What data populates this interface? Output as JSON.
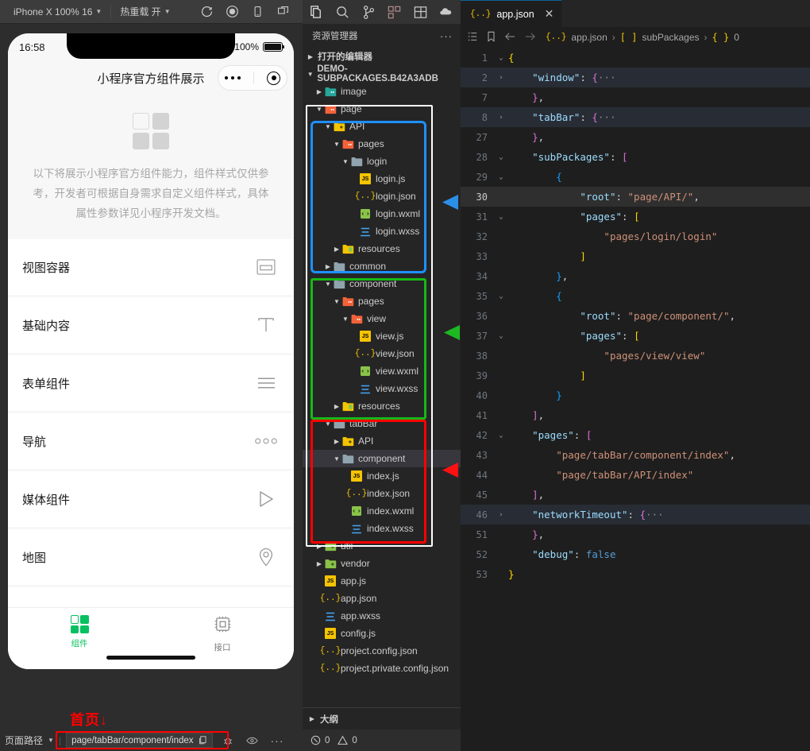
{
  "simulator": {
    "toolbar": {
      "device": "iPhone X 100% 16",
      "hotreload": "热重载 开",
      "icons": [
        "refresh-icon",
        "record-icon",
        "phone-icon",
        "windows-icon"
      ]
    },
    "phone": {
      "status_time": "16:58",
      "battery_percent": "100%",
      "nav_title": "小程序官方组件展示",
      "intro_text": "以下将展示小程序官方组件能力，组件样式仅供参考，开发者可根据自身需求自定义组件样式，具体属性参数详见小程序开发文档。",
      "cards": [
        {
          "label": "视图容器",
          "icon": "view-container-icon"
        },
        {
          "label": "基础内容",
          "icon": "text-format-icon"
        },
        {
          "label": "表单组件",
          "icon": "list-lines-icon"
        },
        {
          "label": "导航",
          "icon": "three-circles-icon"
        },
        {
          "label": "媒体组件",
          "icon": "play-triangle-icon"
        },
        {
          "label": "地图",
          "icon": "map-pin-icon"
        }
      ],
      "tabs": [
        {
          "label": "组件",
          "icon": "grid-icon",
          "active": true
        },
        {
          "label": "接口",
          "icon": "chip-icon",
          "active": false
        }
      ]
    },
    "annotation_home": "首页↓",
    "statusbar": {
      "label": "页面路径",
      "path_value": "page/tabBar/component/index",
      "icons": [
        "copy-icon",
        "debug-icon",
        "eye-icon",
        "more-icon"
      ]
    }
  },
  "explorer": {
    "activity_icons": [
      "files-icon",
      "search-icon",
      "source-control-icon",
      "extensions-icon",
      "layout-icon",
      "cloud-icon"
    ],
    "title": "资源管理器",
    "more": "···",
    "open_editors": "打开的编辑器",
    "project": "DEMO-SUBPACKAGES.B42A3ADB",
    "tree": [
      {
        "label": "image",
        "depth": 1,
        "kind": "folder-img",
        "expanded": false,
        "selected": false
      },
      {
        "label": "page",
        "depth": 1,
        "kind": "folder-page",
        "expanded": true,
        "selected": false
      },
      {
        "label": "API",
        "depth": 2,
        "kind": "folder-api",
        "expanded": true,
        "selected": false
      },
      {
        "label": "pages",
        "depth": 3,
        "kind": "folder-page",
        "expanded": true,
        "selected": false
      },
      {
        "label": "login",
        "depth": 4,
        "kind": "folder",
        "expanded": true,
        "selected": false
      },
      {
        "label": "login.js",
        "depth": 5,
        "kind": "js",
        "selected": false
      },
      {
        "label": "login.json",
        "depth": 5,
        "kind": "json",
        "selected": false
      },
      {
        "label": "login.wxml",
        "depth": 5,
        "kind": "wxml",
        "selected": false
      },
      {
        "label": "login.wxss",
        "depth": 5,
        "kind": "wxss",
        "selected": false
      },
      {
        "label": "resources",
        "depth": 3,
        "kind": "folder-res",
        "expanded": false,
        "selected": false
      },
      {
        "label": "common",
        "depth": 2,
        "kind": "folder-gray",
        "expanded": false,
        "selected": false
      },
      {
        "label": "component",
        "depth": 2,
        "kind": "folder",
        "expanded": true,
        "selected": false
      },
      {
        "label": "pages",
        "depth": 3,
        "kind": "folder-page",
        "expanded": true,
        "selected": false
      },
      {
        "label": "view",
        "depth": 4,
        "kind": "folder-page",
        "expanded": true,
        "selected": false
      },
      {
        "label": "view.js",
        "depth": 5,
        "kind": "js",
        "selected": false
      },
      {
        "label": "view.json",
        "depth": 5,
        "kind": "json",
        "selected": false
      },
      {
        "label": "view.wxml",
        "depth": 5,
        "kind": "wxml",
        "selected": false
      },
      {
        "label": "view.wxss",
        "depth": 5,
        "kind": "wxss",
        "selected": false
      },
      {
        "label": "resources",
        "depth": 3,
        "kind": "folder-res",
        "expanded": false,
        "selected": false
      },
      {
        "label": "tabBar",
        "depth": 2,
        "kind": "folder",
        "expanded": true,
        "selected": false
      },
      {
        "label": "API",
        "depth": 3,
        "kind": "folder-api",
        "expanded": false,
        "selected": false
      },
      {
        "label": "component",
        "depth": 3,
        "kind": "folder",
        "expanded": true,
        "selected": true
      },
      {
        "label": "index.js",
        "depth": 4,
        "kind": "js",
        "selected": false
      },
      {
        "label": "index.json",
        "depth": 4,
        "kind": "json",
        "selected": false
      },
      {
        "label": "index.wxml",
        "depth": 4,
        "kind": "wxml",
        "selected": false
      },
      {
        "label": "index.wxss",
        "depth": 4,
        "kind": "wxss",
        "selected": false
      },
      {
        "label": "util",
        "depth": 1,
        "kind": "folder-util",
        "expanded": false,
        "selected": false
      },
      {
        "label": "vendor",
        "depth": 1,
        "kind": "folder-util",
        "expanded": false,
        "selected": false
      },
      {
        "label": "app.js",
        "depth": 1,
        "kind": "js",
        "selected": false
      },
      {
        "label": "app.json",
        "depth": 1,
        "kind": "json",
        "selected": false
      },
      {
        "label": "app.wxss",
        "depth": 1,
        "kind": "wxss",
        "selected": false
      },
      {
        "label": "config.js",
        "depth": 1,
        "kind": "js",
        "selected": false
      },
      {
        "label": "project.config.json",
        "depth": 1,
        "kind": "json",
        "selected": false
      },
      {
        "label": "project.private.config.json",
        "depth": 1,
        "kind": "json",
        "selected": false
      }
    ],
    "outline": "大纲",
    "status": {
      "errors": "0",
      "warnings": "0"
    }
  },
  "editor": {
    "tab": {
      "label": "app.json",
      "close": "✕"
    },
    "breadcrumb": {
      "file": "app.json",
      "sep1": "›",
      "array": "subPackages",
      "sep2": "›",
      "index": "0"
    },
    "lines": [
      {
        "num": "1",
        "fold": "v",
        "indent": 0,
        "parts": [
          {
            "t": "{",
            "c": "br1"
          }
        ]
      },
      {
        "num": "2",
        "fold": ">",
        "indent": 1,
        "hl": true,
        "parts": [
          {
            "t": "\"window\"",
            "c": "k"
          },
          {
            "t": ": ",
            "c": "p"
          },
          {
            "t": "{",
            "c": "br2"
          },
          {
            "t": "···",
            "c": "ell"
          }
        ]
      },
      {
        "num": "7",
        "fold": "",
        "indent": 1,
        "parts": [
          {
            "t": "}",
            "c": "br2"
          },
          {
            "t": ",",
            "c": "p"
          }
        ]
      },
      {
        "num": "8",
        "fold": ">",
        "indent": 1,
        "hl": true,
        "parts": [
          {
            "t": "\"tabBar\"",
            "c": "k"
          },
          {
            "t": ": ",
            "c": "p"
          },
          {
            "t": "{",
            "c": "br2"
          },
          {
            "t": "···",
            "c": "ell"
          }
        ]
      },
      {
        "num": "27",
        "fold": "",
        "indent": 1,
        "parts": [
          {
            "t": "}",
            "c": "br2"
          },
          {
            "t": ",",
            "c": "p"
          }
        ]
      },
      {
        "num": "28",
        "fold": "v",
        "indent": 1,
        "parts": [
          {
            "t": "\"subPackages\"",
            "c": "k"
          },
          {
            "t": ": ",
            "c": "p"
          },
          {
            "t": "[",
            "c": "br2"
          }
        ]
      },
      {
        "num": "29",
        "fold": "v",
        "indent": 2,
        "parts": [
          {
            "t": "{",
            "c": "br3"
          }
        ]
      },
      {
        "num": "30",
        "fold": "",
        "indent": 3,
        "cur": true,
        "active": true,
        "parts": [
          {
            "t": "\"root\"",
            "c": "k"
          },
          {
            "t": ": ",
            "c": "p"
          },
          {
            "t": "\"page/API/\"",
            "c": "s"
          },
          {
            "t": ",",
            "c": "p"
          }
        ]
      },
      {
        "num": "31",
        "fold": "v",
        "indent": 3,
        "parts": [
          {
            "t": "\"pages\"",
            "c": "k"
          },
          {
            "t": ": ",
            "c": "p"
          },
          {
            "t": "[",
            "c": "br1"
          }
        ]
      },
      {
        "num": "32",
        "fold": "",
        "indent": 4,
        "parts": [
          {
            "t": "\"pages/login/login\"",
            "c": "s"
          }
        ]
      },
      {
        "num": "33",
        "fold": "",
        "indent": 3,
        "parts": [
          {
            "t": "]",
            "c": "br1"
          }
        ]
      },
      {
        "num": "34",
        "fold": "",
        "indent": 2,
        "parts": [
          {
            "t": "}",
            "c": "br3"
          },
          {
            "t": ",",
            "c": "p"
          }
        ]
      },
      {
        "num": "35",
        "fold": "v",
        "indent": 2,
        "parts": [
          {
            "t": "{",
            "c": "br3"
          }
        ]
      },
      {
        "num": "36",
        "fold": "",
        "indent": 3,
        "parts": [
          {
            "t": "\"root\"",
            "c": "k"
          },
          {
            "t": ": ",
            "c": "p"
          },
          {
            "t": "\"page/component/\"",
            "c": "s"
          },
          {
            "t": ",",
            "c": "p"
          }
        ]
      },
      {
        "num": "37",
        "fold": "v",
        "indent": 3,
        "parts": [
          {
            "t": "\"pages\"",
            "c": "k"
          },
          {
            "t": ": ",
            "c": "p"
          },
          {
            "t": "[",
            "c": "br1"
          }
        ]
      },
      {
        "num": "38",
        "fold": "",
        "indent": 4,
        "parts": [
          {
            "t": "\"pages/view/view\"",
            "c": "s"
          }
        ]
      },
      {
        "num": "39",
        "fold": "",
        "indent": 3,
        "parts": [
          {
            "t": "]",
            "c": "br1"
          }
        ]
      },
      {
        "num": "40",
        "fold": "",
        "indent": 2,
        "parts": [
          {
            "t": "}",
            "c": "br3"
          }
        ]
      },
      {
        "num": "41",
        "fold": "",
        "indent": 1,
        "parts": [
          {
            "t": "]",
            "c": "br2"
          },
          {
            "t": ",",
            "c": "p"
          }
        ]
      },
      {
        "num": "42",
        "fold": "v",
        "indent": 1,
        "parts": [
          {
            "t": "\"pages\"",
            "c": "k"
          },
          {
            "t": ": ",
            "c": "p"
          },
          {
            "t": "[",
            "c": "br2"
          }
        ]
      },
      {
        "num": "43",
        "fold": "",
        "indent": 2,
        "parts": [
          {
            "t": "\"page/tabBar/component/index\"",
            "c": "s"
          },
          {
            "t": ",",
            "c": "p"
          }
        ]
      },
      {
        "num": "44",
        "fold": "",
        "indent": 2,
        "parts": [
          {
            "t": "\"page/tabBar/API/index\"",
            "c": "s"
          }
        ]
      },
      {
        "num": "45",
        "fold": "",
        "indent": 1,
        "parts": [
          {
            "t": "]",
            "c": "br2"
          },
          {
            "t": ",",
            "c": "p"
          }
        ]
      },
      {
        "num": "46",
        "fold": ">",
        "indent": 1,
        "hl": true,
        "parts": [
          {
            "t": "\"networkTimeout\"",
            "c": "k"
          },
          {
            "t": ": ",
            "c": "p"
          },
          {
            "t": "{",
            "c": "br2"
          },
          {
            "t": "···",
            "c": "ell"
          }
        ]
      },
      {
        "num": "51",
        "fold": "",
        "indent": 1,
        "parts": [
          {
            "t": "}",
            "c": "br2"
          },
          {
            "t": ",",
            "c": "p"
          }
        ]
      },
      {
        "num": "52",
        "fold": "",
        "indent": 1,
        "parts": [
          {
            "t": "\"debug\"",
            "c": "k"
          },
          {
            "t": ": ",
            "c": "p"
          },
          {
            "t": "false",
            "c": "bool"
          }
        ]
      },
      {
        "num": "53",
        "fold": "",
        "indent": 0,
        "parts": [
          {
            "t": "}",
            "c": "br1"
          }
        ]
      }
    ]
  },
  "annotations": {
    "colors": {
      "blue": "#1e90ff",
      "green": "#16b916",
      "red": "#ff0000",
      "white": "#ffffff"
    },
    "arrows": [
      {
        "name": "blue-arrow",
        "color": "#1e90ff"
      },
      {
        "name": "green-arrow",
        "color": "#16b916"
      },
      {
        "name": "red-arrow",
        "color": "#ff0000"
      }
    ]
  }
}
